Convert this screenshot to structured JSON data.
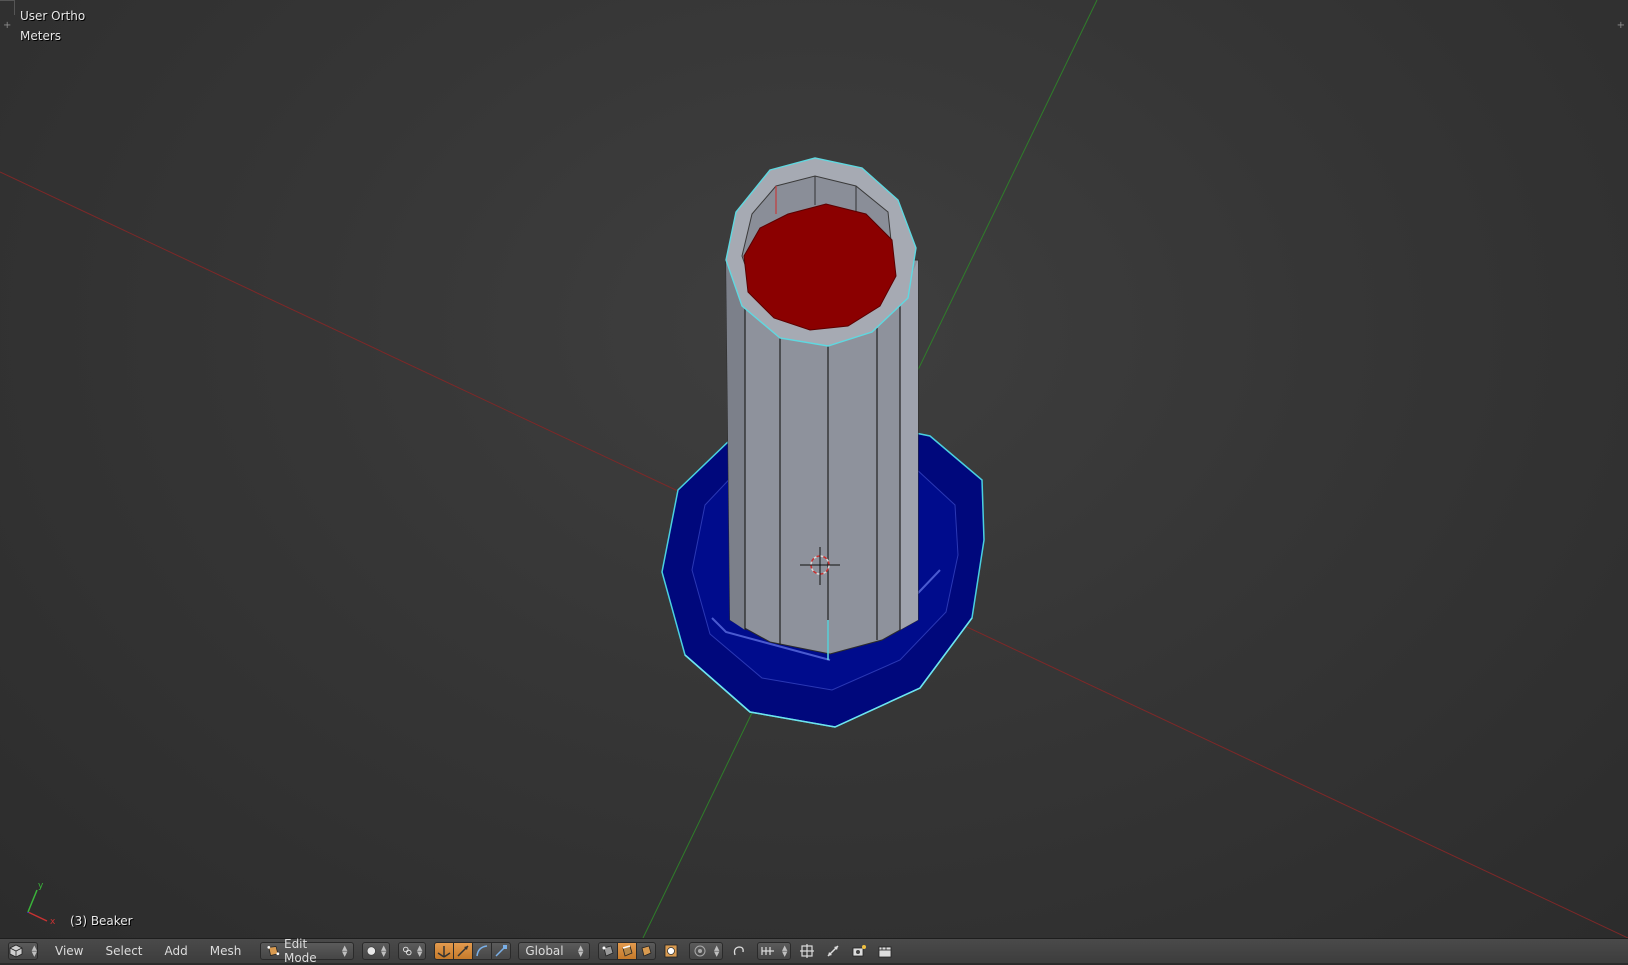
{
  "viewport": {
    "view_name": "User Ortho",
    "units": "Meters",
    "object_info": "(3) Beaker",
    "colors": {
      "background": "#393939",
      "x_axis": "#8a2a2a",
      "y_axis": "#3a8a2a",
      "selected_faces": "#00087c",
      "inner_face": "#8b0000",
      "mesh_grey": "#8e929c",
      "selected_edge": "#5fd8e0"
    },
    "axis_gizmo": {
      "x_label": "x",
      "y_label": "y"
    }
  },
  "header": {
    "editor_type_icon": "cube-3d-icon",
    "menus": [
      "View",
      "Select",
      "Add",
      "Mesh"
    ],
    "mode": "Edit Mode",
    "mode_icon": "edit-mode-icon",
    "shading_icon": "solid-sphere-icon",
    "pivot_icon": "pivot-median-icon",
    "manipulator_icons": [
      "manipulator-toggle-icon",
      "translate-arrow-icon",
      "rotate-arc-icon",
      "scale-arrow-icon"
    ],
    "orientation": "Global",
    "select_mode_icons": [
      "vertex-select-icon",
      "edge-select-icon",
      "face-select-icon"
    ],
    "occlude_icon": "occlude-geometry-icon",
    "proportional_icon": "proportional-edit-icon",
    "snap_icons": [
      "snap-toggle-icon",
      "snap-increment-icon",
      "snap-target-icon"
    ],
    "extra_icons": [
      "mirror-icon",
      "render-camera-icon",
      "render-anim-icon"
    ]
  }
}
